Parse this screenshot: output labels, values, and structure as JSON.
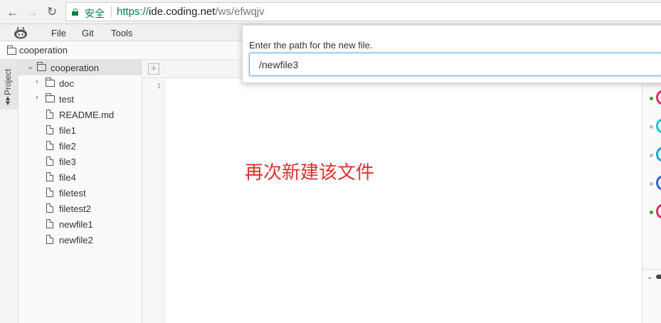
{
  "browser": {
    "secure_label": "安全",
    "url_scheme": "https://",
    "url_host": "ide.coding.net",
    "url_path": "/ws/efwqjv"
  },
  "menu": {
    "items": [
      {
        "label": "File"
      },
      {
        "label": "Git"
      },
      {
        "label": "Tools"
      }
    ]
  },
  "breadcrumb": {
    "label": "cooperation"
  },
  "sidebar": {
    "project_tab": "Project"
  },
  "tree": {
    "root": "cooperation",
    "folders": [
      {
        "label": "doc"
      },
      {
        "label": "test"
      }
    ],
    "files": [
      {
        "label": "README.md"
      },
      {
        "label": "file1"
      },
      {
        "label": "file2"
      },
      {
        "label": "file3"
      },
      {
        "label": "file4"
      },
      {
        "label": "filetest"
      },
      {
        "label": "filetest2"
      },
      {
        "label": "newfile1"
      },
      {
        "label": "newfile2"
      }
    ]
  },
  "editor": {
    "line_number": "1",
    "annotation": "再次新建该文件"
  },
  "collaborators": [
    {
      "ring": "#e8245f",
      "dot": "#22aa22"
    },
    {
      "ring": "#19c4d6",
      "dot": "#bbbbbb"
    },
    {
      "ring": "#1aa0e8",
      "dot": "#bbbbbb"
    },
    {
      "ring": "#2c5fe8",
      "dot": "#bbbbbb"
    },
    {
      "ring": "#e8245f",
      "dot": "#22aa22"
    }
  ],
  "dialog": {
    "prompt": "Enter the path for the new file.",
    "input_value": "/newfile3"
  }
}
